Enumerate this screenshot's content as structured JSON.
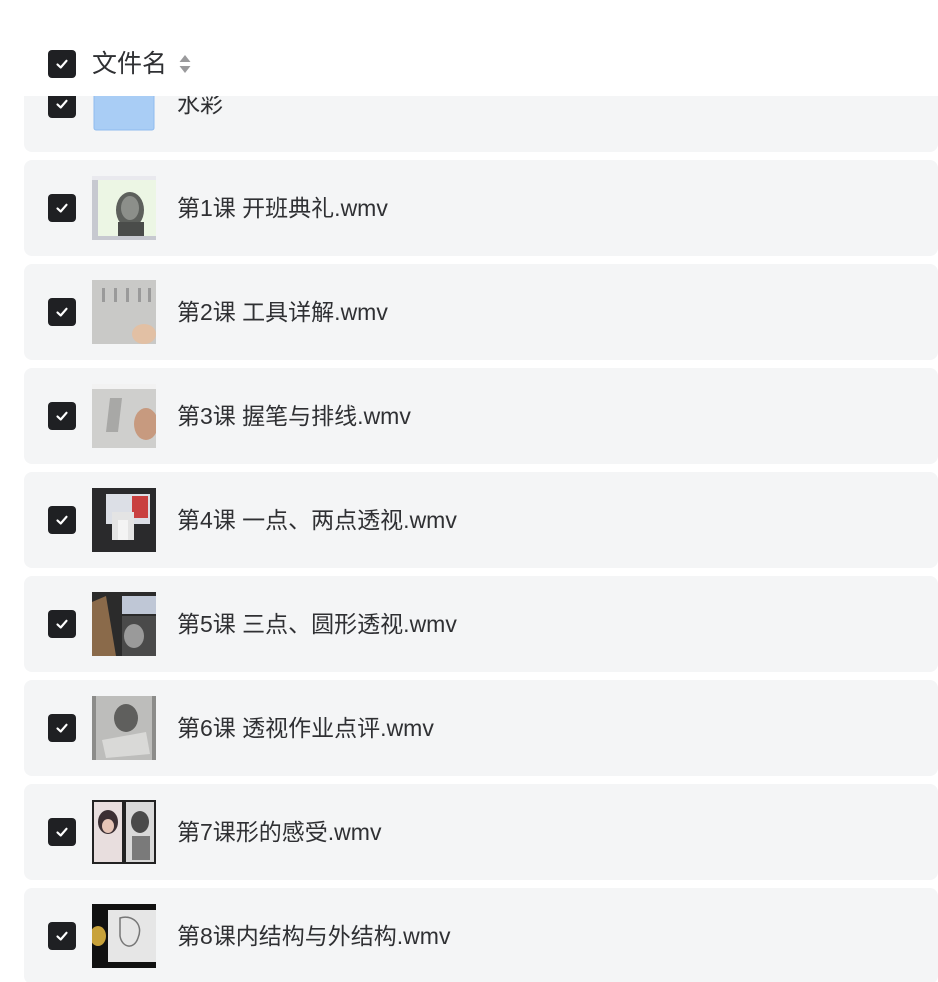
{
  "header": {
    "title": "文件名",
    "checked": true
  },
  "files": [
    {
      "name": "水彩",
      "kind": "folder",
      "checked": true
    },
    {
      "name": "第1课 开班典礼.wmv",
      "kind": "video",
      "checked": true
    },
    {
      "name": "第2课 工具详解.wmv",
      "kind": "video",
      "checked": true
    },
    {
      "name": "第3课 握笔与排线.wmv",
      "kind": "video",
      "checked": true
    },
    {
      "name": "第4课 一点、两点透视.wmv",
      "kind": "video",
      "checked": true
    },
    {
      "name": "第5课 三点、圆形透视.wmv",
      "kind": "video",
      "checked": true
    },
    {
      "name": "第6课 透视作业点评.wmv",
      "kind": "video",
      "checked": true
    },
    {
      "name": "第7课形的感受.wmv",
      "kind": "video",
      "checked": true
    },
    {
      "name": "第8课内结构与外结构.wmv",
      "kind": "video",
      "checked": true
    }
  ],
  "icons": {
    "checkbox": "checkmark-icon",
    "sort": "sort-icon",
    "folder": "folder-icon"
  },
  "colors": {
    "checkbox_fill": "#1f2023",
    "row_background": "#f4f5f6",
    "folder_blue": "#a9cdf5"
  }
}
